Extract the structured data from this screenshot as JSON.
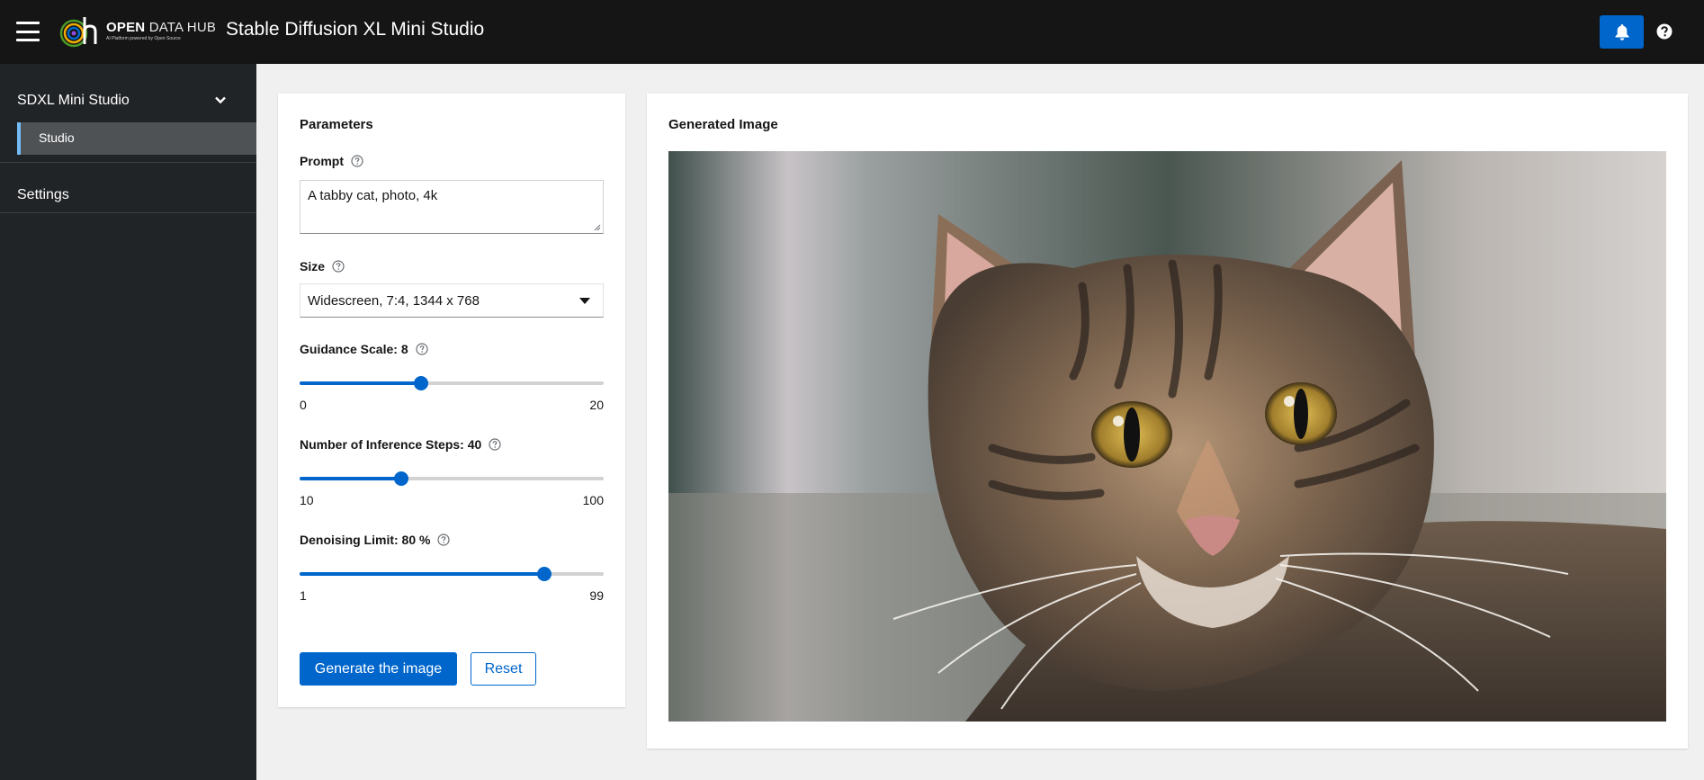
{
  "header": {
    "brand_name": "OPEN",
    "brand_name_light": "DATA HUB",
    "brand_tagline": "AI Platform powered by Open Source",
    "app_title": "Stable Diffusion XL Mini Studio",
    "icons": [
      "menu-icon",
      "bell-icon",
      "help-icon"
    ],
    "accent": "#0066cc"
  },
  "sidebar": {
    "group_label": "SDXL Mini Studio",
    "group_items": [
      {
        "label": "Studio",
        "active": true
      }
    ],
    "items": [
      {
        "label": "Settings"
      }
    ]
  },
  "parameters": {
    "title": "Parameters",
    "prompt": {
      "label": "Prompt",
      "value": "A tabby cat, photo, 4k"
    },
    "size": {
      "label": "Size",
      "value": "Widescreen, 7:4, 1344 x 768"
    },
    "guidance": {
      "label": "Guidance Scale: 8",
      "value": 8,
      "min": 0,
      "max": 20,
      "min_label": "0",
      "max_label": "20"
    },
    "steps": {
      "label": "Number of Inference Steps: 40",
      "value": 40,
      "min": 10,
      "max": 100,
      "min_label": "10",
      "max_label": "100"
    },
    "denoising": {
      "label": "Denoising Limit: 80 %",
      "value": 80,
      "min": 1,
      "max": 99,
      "min_label": "1",
      "max_label": "99"
    },
    "generate_label": "Generate the image",
    "reset_label": "Reset"
  },
  "result": {
    "title": "Generated Image",
    "image_subject": "tabby cat close-up photo"
  }
}
